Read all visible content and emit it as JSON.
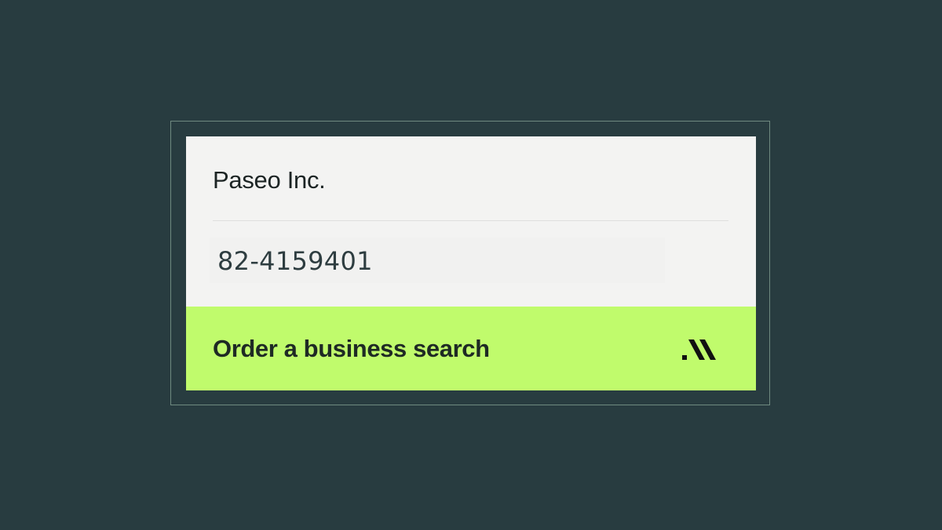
{
  "card": {
    "company_name": "Paseo Inc.",
    "ein": "82-4159401",
    "button_label": "Order a business search",
    "button_icon": "slash-stripes-icon"
  },
  "colors": {
    "background": "#283c40",
    "card": "#f3f3f2",
    "accent": "#c0fb6c",
    "text": "#1c2424"
  }
}
